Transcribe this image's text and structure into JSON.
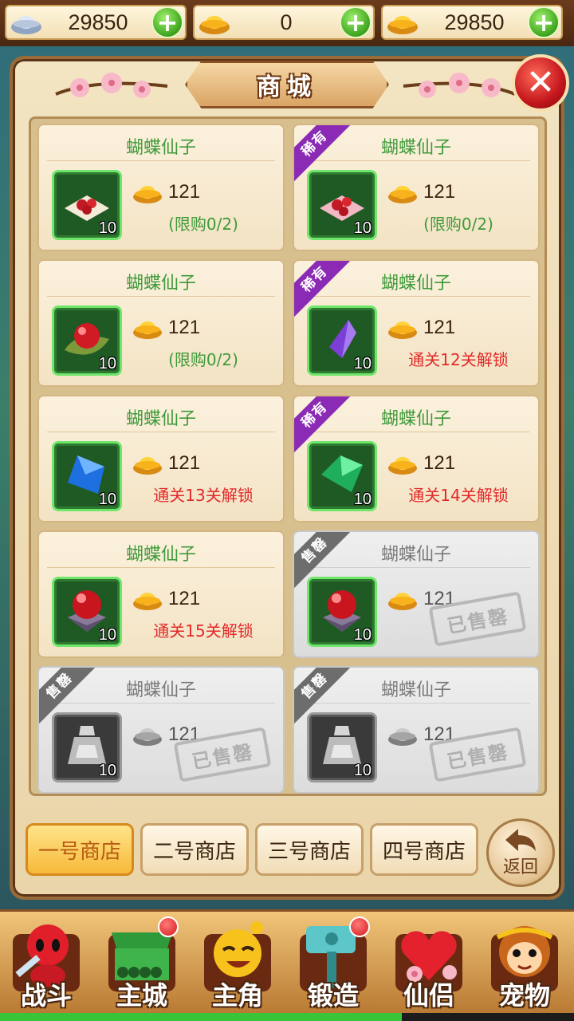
{
  "currency": [
    {
      "icon": "silver-ingot-icon",
      "value": "29850"
    },
    {
      "icon": "gold-ingot-icon",
      "value": "0"
    },
    {
      "icon": "gold-ingot-icon",
      "value": "29850"
    }
  ],
  "shop": {
    "title": "商城",
    "close_icon": "close-icon",
    "items": [
      {
        "name": "蝴蝶仙子",
        "qty": "10",
        "price": "121",
        "note": "(限购0/2)",
        "note_color": "green",
        "ribbon": "",
        "sold": false,
        "icon": "red-berries-on-cloth-icon"
      },
      {
        "name": "蝴蝶仙子",
        "qty": "10",
        "price": "121",
        "note": "(限购0/2)",
        "note_color": "green",
        "ribbon": "稀有",
        "sold": false,
        "icon": "red-berries-on-pink-cloth-icon"
      },
      {
        "name": "蝴蝶仙子",
        "qty": "10",
        "price": "121",
        "note": "(限购0/2)",
        "note_color": "green",
        "ribbon": "",
        "sold": false,
        "icon": "red-orb-on-leaf-icon"
      },
      {
        "name": "蝴蝶仙子",
        "qty": "10",
        "price": "121",
        "note": "通关12关解锁",
        "note_color": "red",
        "ribbon": "稀有",
        "sold": false,
        "icon": "purple-crystal-icon"
      },
      {
        "name": "蝴蝶仙子",
        "qty": "10",
        "price": "121",
        "note": "通关13关解锁",
        "note_color": "red",
        "ribbon": "",
        "sold": false,
        "icon": "blue-gem-icon"
      },
      {
        "name": "蝴蝶仙子",
        "qty": "10",
        "price": "121",
        "note": "通关14关解锁",
        "note_color": "red",
        "ribbon": "稀有",
        "sold": false,
        "icon": "green-gem-icon"
      },
      {
        "name": "蝴蝶仙子",
        "qty": "10",
        "price": "121",
        "note": "通关15关解锁",
        "note_color": "red",
        "ribbon": "",
        "sold": false,
        "icon": "red-orb-on-pedestal-icon"
      },
      {
        "name": "蝴蝶仙子",
        "qty": "10",
        "price": "121",
        "note": "",
        "note_color": "",
        "ribbon": "售罄",
        "sold": true,
        "stamp": "已售罄",
        "grey": false,
        "icon": "red-orb-on-pedestal-icon"
      },
      {
        "name": "蝴蝶仙子",
        "qty": "10",
        "price": "121",
        "note": "",
        "note_color": "",
        "ribbon": "售罄",
        "sold": true,
        "stamp": "已售罄",
        "grey": true,
        "icon": "grey-bag-icon"
      },
      {
        "name": "蝴蝶仙子",
        "qty": "10",
        "price": "121",
        "note": "",
        "note_color": "",
        "ribbon": "售罄",
        "sold": true,
        "stamp": "已售罄",
        "grey": true,
        "icon": "grey-bag-icon"
      }
    ],
    "tabs": [
      {
        "label": "一号商店",
        "active": true
      },
      {
        "label": "二号商店",
        "active": false
      },
      {
        "label": "三号商店",
        "active": false
      },
      {
        "label": "四号商店",
        "active": false
      }
    ],
    "back_label": "返回"
  },
  "bottom_nav": [
    {
      "label": "战斗",
      "icon": "red-warrior-icon",
      "badge": false
    },
    {
      "label": "主城",
      "icon": "green-city-gate-icon",
      "badge": true
    },
    {
      "label": "主角",
      "icon": "yellow-hero-icon",
      "badge": false
    },
    {
      "label": "锻造",
      "icon": "hammer-icon",
      "badge": true
    },
    {
      "label": "仙侣",
      "icon": "heart-icon",
      "badge": false
    },
    {
      "label": "宠物",
      "icon": "monkey-icon",
      "badge": false
    }
  ],
  "progress": 0.7
}
